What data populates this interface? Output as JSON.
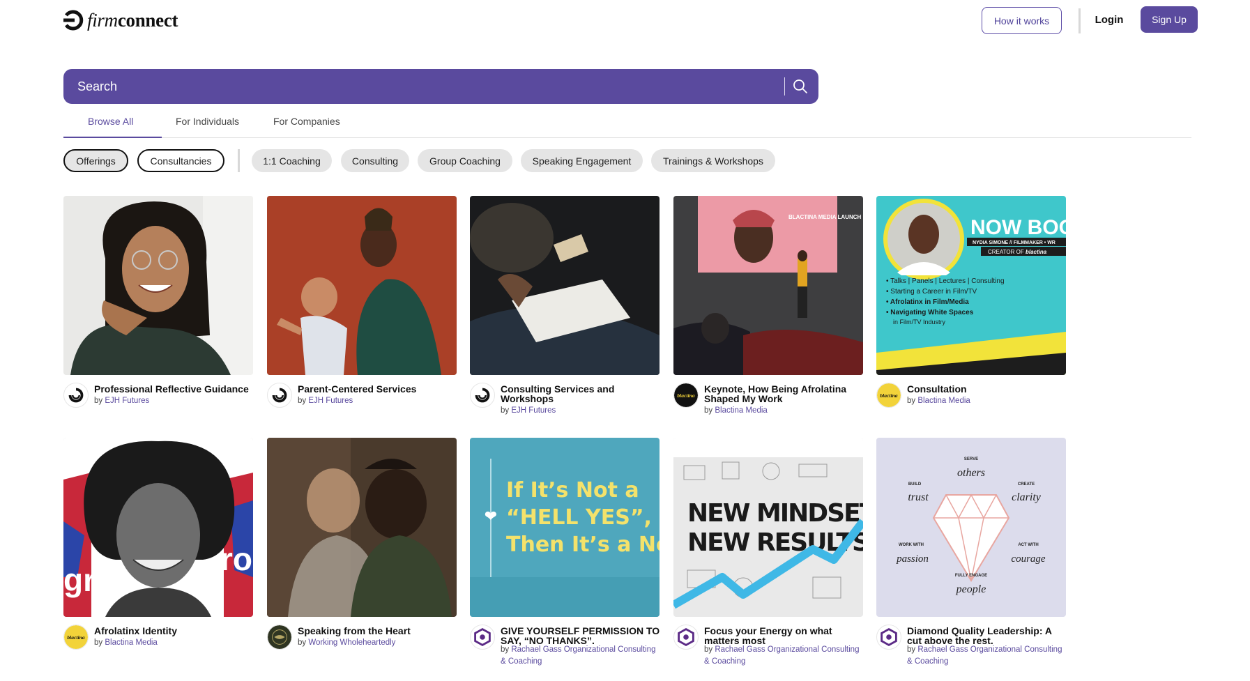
{
  "brand": {
    "prefix": "firm",
    "suffix": "connect"
  },
  "header": {
    "how_it_works": "How it works",
    "login": "Login",
    "signup": "Sign Up"
  },
  "search": {
    "placeholder": "Search"
  },
  "tabs": [
    {
      "label": "Browse All",
      "active": true
    },
    {
      "label": "For Individuals",
      "active": false
    },
    {
      "label": "For Companies",
      "active": false
    }
  ],
  "type_chips": [
    {
      "label": "Offerings",
      "selected": true
    },
    {
      "label": "Consultancies",
      "selected": false
    }
  ],
  "category_chips": [
    {
      "label": "1:1 Coaching"
    },
    {
      "label": "Consulting"
    },
    {
      "label": "Group Coaching"
    },
    {
      "label": "Speaking Engagement"
    },
    {
      "label": "Trainings & Workshops"
    }
  ],
  "colors": {
    "brand": "#5a4a9e",
    "chip_bg": "#e5e5e5"
  },
  "cards": [
    {
      "title": "Professional Reflective Guidance",
      "by": "by",
      "company": "EJH Futures",
      "avatar_icon": "ejh-logo-icon"
    },
    {
      "title": "Parent-Centered Services",
      "by": "by",
      "company": "EJH Futures",
      "avatar_icon": "ejh-logo-icon"
    },
    {
      "title": "Consulting Services and Workshops",
      "by": "by",
      "company": "EJH Futures",
      "avatar_icon": "ejh-logo-icon"
    },
    {
      "title": "Keynote, How Being Afrolatina Shaped My Work",
      "by": "by",
      "company": "Blactina Media",
      "avatar_icon": "blactina-logo-icon"
    },
    {
      "title": "Consultation",
      "by": "by",
      "company": "Blactina Media",
      "avatar_icon": "blactina-logo-icon"
    },
    {
      "title": "Afrolatinx Identity",
      "by": "by",
      "company": "Blactina Media",
      "avatar_icon": "blactina-logo-icon"
    },
    {
      "title": "Speaking from the Heart",
      "by": "by",
      "company": "Working Wholeheartedly",
      "avatar_icon": "working-wholeheartedly-logo-icon"
    },
    {
      "title": "GIVE YOURSELF PERMISSION TO SAY, “NO THANKS”.",
      "by": "by",
      "company": "Rachael Gass Organizational Consulting & Coaching",
      "avatar_icon": "rachael-gass-logo-icon"
    },
    {
      "title": "Focus your Energy on what matters most",
      "by": "by",
      "company": "Rachael Gass Organizational Consulting & Coaching",
      "avatar_icon": "rachael-gass-logo-icon"
    },
    {
      "title": "Diamond Quality Leadership: A cut above the rest.",
      "by": "by",
      "company": "Rachael Gass Organizational Consulting & Coaching",
      "avatar_icon": "rachael-gass-logo-icon"
    }
  ],
  "image_text": {
    "blactina_launch": "BLACTINA MEDIA LAUNCH",
    "nowboo": "NOW BOO",
    "nydia": "NYDIA SIMONE // FILMMAKER • WR",
    "creator": "CREATOR OF",
    "creator_brand": "blactina",
    "bullets": [
      "• Talks | Panels | Lectures | Consulting",
      "• Starting a Career in Film/TV",
      "• Afrolatinx in Film/Media",
      "• Navigating White Spaces",
      "in Film/TV Industry"
    ],
    "hellyes": [
      "If It’s Not a",
      "“HELL YES”,",
      "Then It’s a No."
    ],
    "mindset": [
      "NEW MINDSET",
      "NEW RESULTS"
    ],
    "diamond": {
      "serve": "SERVE",
      "others": "others",
      "build": "BUILD",
      "trust": "trust",
      "create": "CREATE",
      "clarity": "clarity",
      "work_with": "WORK WITH",
      "passion": "passion",
      "act_with": "ACT WITH",
      "courage": "courage",
      "fully_engage": "FULLY ENGAGE",
      "people": "people"
    },
    "poster_words": [
      "gra",
      "ro"
    ],
    "blactina_avatar": "blactina"
  }
}
